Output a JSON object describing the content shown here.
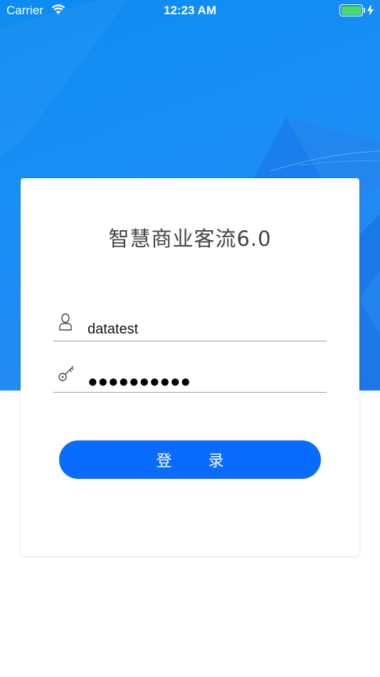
{
  "status_bar": {
    "carrier": "Carrier",
    "time": "12:23 AM",
    "battery_color": "#4cd964"
  },
  "theme": {
    "hero_color": "#1a8ef5",
    "button_color": "#0a6cff"
  },
  "login": {
    "app_title": "智慧商业客流6.0",
    "username_icon": "user-icon",
    "username": "datatest",
    "password_icon": "key-icon",
    "password_masked": "●●●●●●●●●●",
    "login_label": "登 录"
  }
}
